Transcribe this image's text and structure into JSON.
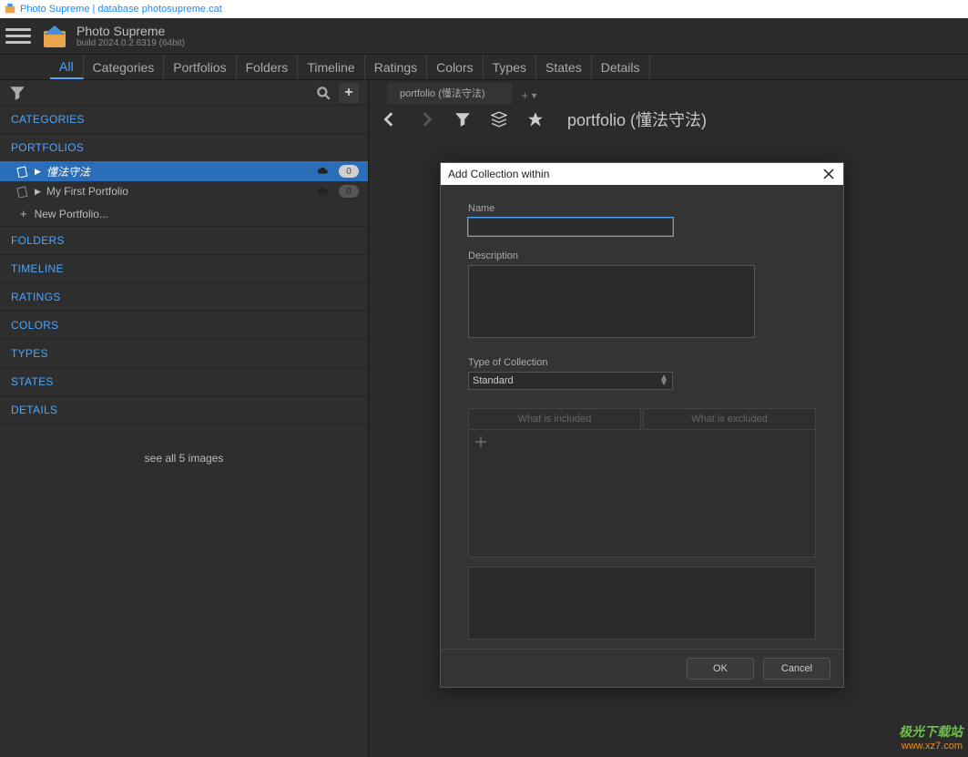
{
  "window": {
    "title": "Photo Supreme | database photosupreme.cat"
  },
  "header": {
    "app_name": "Photo Supreme",
    "build": "build 2024.0.2.6319 (64bit)"
  },
  "nav": {
    "all": "All",
    "tabs": [
      "Categories",
      "Portfolios",
      "Folders",
      "Timeline",
      "Ratings",
      "Colors",
      "Types",
      "States",
      "Details"
    ]
  },
  "sidebar": {
    "sections": {
      "categories": "CATEGORIES",
      "portfolios": "PORTFOLIOS",
      "folders": "FOLDERS",
      "timeline": "TIMELINE",
      "ratings": "RATINGS",
      "colors": "COLORS",
      "types": "TYPES",
      "states": "STATES",
      "details": "DETAILS"
    },
    "portfolios": [
      {
        "label": "懂法守法",
        "count": "0",
        "selected": true
      },
      {
        "label": "My First Portfolio",
        "count": "0",
        "selected": false
      }
    ],
    "new_portfolio": "New Portfolio...",
    "see_all": "see all 5 images"
  },
  "content": {
    "tab_label": "portfolio (懂法守法)",
    "breadcrumb": "portfolio (懂法守法)"
  },
  "dialog": {
    "title": "Add Collection within",
    "labels": {
      "name": "Name",
      "description": "Description",
      "type": "Type of Collection"
    },
    "type_value": "Standard",
    "tabs": {
      "included": "What is included",
      "excluded": "What is excluded"
    },
    "buttons": {
      "ok": "OK",
      "cancel": "Cancel"
    }
  },
  "watermark": {
    "line1": "极光下载站",
    "line2": "www.xz7.com"
  }
}
